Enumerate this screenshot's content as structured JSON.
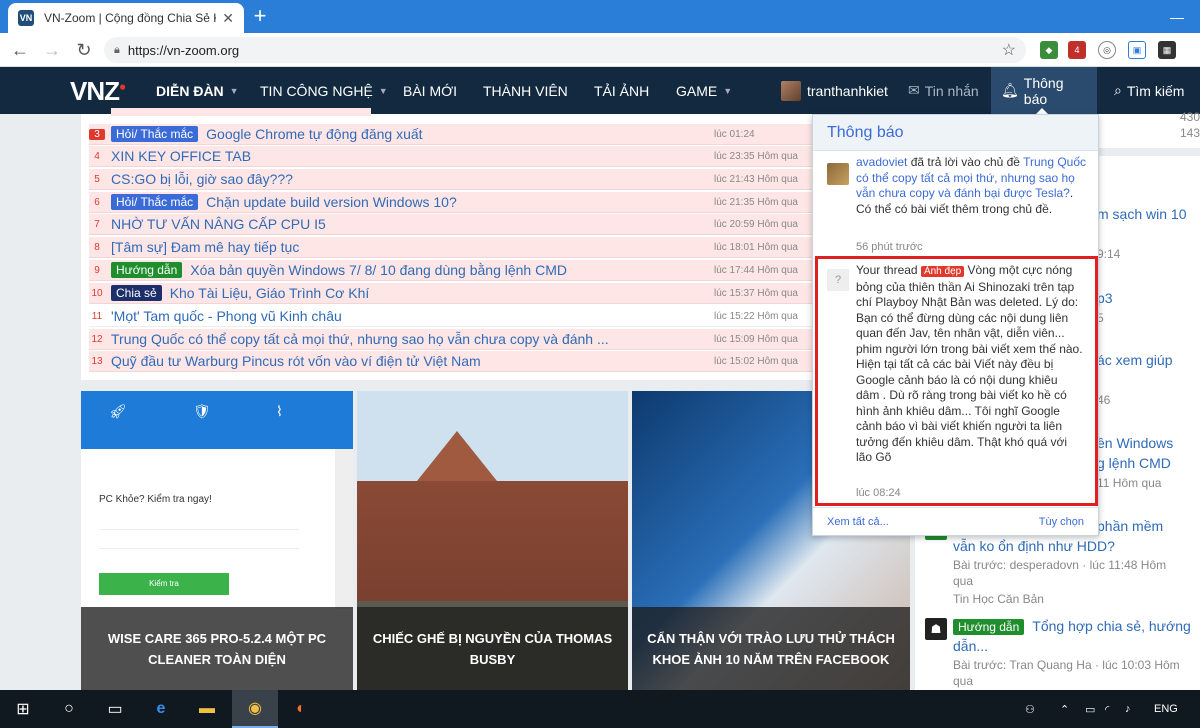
{
  "browser": {
    "tab_title": "VN-Zoom | Cộng đồng Chia Sẻ K",
    "tab_favicon": "VN",
    "new_tab": "+",
    "url": "https://vn-zoom.org",
    "ext_badge_count": "4"
  },
  "site": {
    "logo": "VNZ",
    "nav": {
      "forum": "DIỄN ĐÀN",
      "tech": "TIN CÔNG NGHỆ",
      "new_posts": "BÀI MỚI",
      "members": "THÀNH VIÊN",
      "upload": "TẢI ẢNH",
      "game": "GAME",
      "username": "tranthanhkiet",
      "messages": "Tin nhắn",
      "alerts": "Thông báo",
      "search": "Tìm kiếm"
    }
  },
  "threads": [
    {
      "num": "3",
      "tag": "Hỏi/ Thắc mắc",
      "tag_type": "hoi",
      "title": "Google Chrome tự động đăng xuất",
      "time": "lúc 01:24",
      "style": "pink"
    },
    {
      "num": "4",
      "tag": "",
      "tag_type": "",
      "title": "XIN KEY OFFICE TAB",
      "time": "lúc 23:35 Hôm qua",
      "style": "pink"
    },
    {
      "num": "5",
      "tag": "",
      "tag_type": "",
      "title": "CS:GO bị lỗi, giờ sao đây???",
      "time": "lúc 21:43 Hôm qua",
      "style": "pink"
    },
    {
      "num": "6",
      "tag": "Hỏi/ Thắc mắc",
      "tag_type": "hoi",
      "title": "Chặn update build version Windows 10?",
      "time": "lúc 21:35 Hôm qua",
      "style": "pink"
    },
    {
      "num": "7",
      "tag": "",
      "tag_type": "",
      "title": "NHỜ TƯ VẤN NÂNG CẤP CPU I5",
      "time": "lúc 20:59 Hôm qua",
      "style": "pink"
    },
    {
      "num": "8",
      "tag": "",
      "tag_type": "",
      "title": "[Tâm sự] Đam mê hay tiếp tục",
      "time": "lúc 18:01 Hôm qua",
      "style": "pink"
    },
    {
      "num": "9",
      "tag": "Hướng dẫn",
      "tag_type": "huong",
      "title": "Xóa bản quyền Windows 7/ 8/ 10 đang dùng bằng lệnh CMD",
      "time": "lúc 17:44 Hôm qua",
      "style": "pink"
    },
    {
      "num": "10",
      "tag": "Chia sẻ",
      "tag_type": "chia",
      "title": "Kho Tài Liệu, Giáo Trình Cơ Khí",
      "time": "lúc 15:37 Hôm qua",
      "style": "pink"
    },
    {
      "num": "11",
      "tag": "",
      "tag_type": "",
      "title": "'Mọt' Tam quốc - Phong vũ Kinh châu",
      "time": "lúc 15:22 Hôm qua",
      "style": "white"
    },
    {
      "num": "12",
      "tag": "",
      "tag_type": "",
      "title": "Trung Quốc có thể copy tất cả mọi thứ, nhưng sao họ vẫn chưa copy và đánh ...",
      "time": "lúc 15:09 Hôm qua",
      "style": "pink"
    },
    {
      "num": "13",
      "tag": "",
      "tag_type": "",
      "title": "Quỹ đầu tư Warburg Pincus rót vốn vào ví điện tử Việt Nam",
      "time": "lúc 15:02 Hôm qua",
      "style": "pink"
    }
  ],
  "featured": [
    {
      "caption": "WISE CARE 365 PRO-5.2.4 MỘT PC CLEANER TOÀN DIỆN",
      "panel_text": "PC Khỏe? Kiểm tra ngay!",
      "button": "Kiểm tra"
    },
    {
      "caption": "CHIẾC GHẾ BỊ NGUYỀN CỦA THOMAS BUSBY"
    },
    {
      "caption": "CẨN THẬN VỚI TRÀO LƯU THỬ THÁCH KHOE ẢNH 10 NĂM TRÊN FACEBOOK"
    }
  ],
  "sidebar": {
    "stat1": "430",
    "stat2": "143",
    "frag1": "m sạch win 10",
    "frag2": "9:14",
    "frag3": "p3",
    "frag4": "5",
    "frag5": "ác xem giúp",
    "frag6": "46",
    "frag7": "ền Windows",
    "frag8": "g lệnh CMD",
    "frag9": "11 Hôm qua",
    "item1_title": "phần mềm",
    "item1_title2": "vẫn ko ổn định như HDD?",
    "item1_meta": "Bài trước: desperadovn · lúc 11:48 Hôm",
    "item1_meta2": "qua",
    "item1_forum": "Tin Học Căn Bản",
    "item2_tag": "Hướng dẫn",
    "item2_title": "Tổng hợp chia sẻ, hướng",
    "item2_title2": "dẫn...",
    "item2_meta": "Bài trước: Tran Quang Ha · lúc 10:03 Hôm",
    "item2_meta2": "qua"
  },
  "notifications": {
    "header": "Thông báo",
    "item1": {
      "user": "avadoviet",
      "action": " đã trả lời vào chủ đề ",
      "thread": "Trung Quốc có thể copy tất cả mọi thứ, nhưng sao họ vẫn chưa copy và đánh bại được Tesla?",
      "suffix": ". Có thể có bài viết thêm trong chủ đề.",
      "time": "56 phút trước"
    },
    "item2": {
      "prefix": "Your thread ",
      "tag": "Ảnh đẹp",
      "body": " Vòng một cực nóng bỏng của thiên thần Ai Shinozaki trên tạp chí Playboy Nhật Bản was deleted. Lý do: Bạn có thể đừng dùng các nội dung liên quan đến Jav, tên nhân vật, diễn viên... phim người lớn trong bài viết xem thế nào. Hiện tại tất cả các bài Viết này đều bị Google cảnh báo là có nội dung khiêu dâm . Dù rõ ràng trong bài viết ko hề có hình ảnh khiêu dâm... Tôi nghĩ Google cảnh báo vì bài viết khiến người ta liên tưởng đến khiêu dâm. Thật khó quá với lão Gõ",
      "time": "lúc 08:24",
      "avatar_glyph": "?"
    },
    "see_all": "Xem tất cả...",
    "options": "Tùy chọn"
  },
  "taskbar": {
    "lang": "ENG"
  }
}
